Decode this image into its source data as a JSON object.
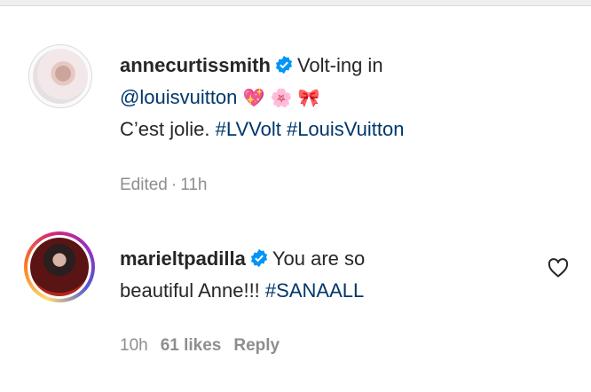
{
  "comments": [
    {
      "username": "annecurtissmith",
      "verified": true,
      "text_line1": "Volt-ing in",
      "mention": "@louisvuitton",
      "emojis": [
        "💖",
        "🌸",
        "🎀"
      ],
      "text_line3": "C’est jolie.",
      "hashtags": [
        "#LVVolt",
        "#LouisVuitton"
      ],
      "meta": {
        "status": "Edited",
        "separator": "·",
        "time": "11h"
      }
    },
    {
      "username": "marieltpadilla",
      "verified": true,
      "text_part1": "You are so",
      "text_part2": "beautiful Anne!!!",
      "hashtag": "#SANAALL",
      "meta": {
        "time": "10h",
        "likes": "61 likes",
        "reply": "Reply"
      }
    }
  ],
  "colors": {
    "link": "#00376b",
    "verified": "#0095f6",
    "meta": "#8e8e8e"
  }
}
